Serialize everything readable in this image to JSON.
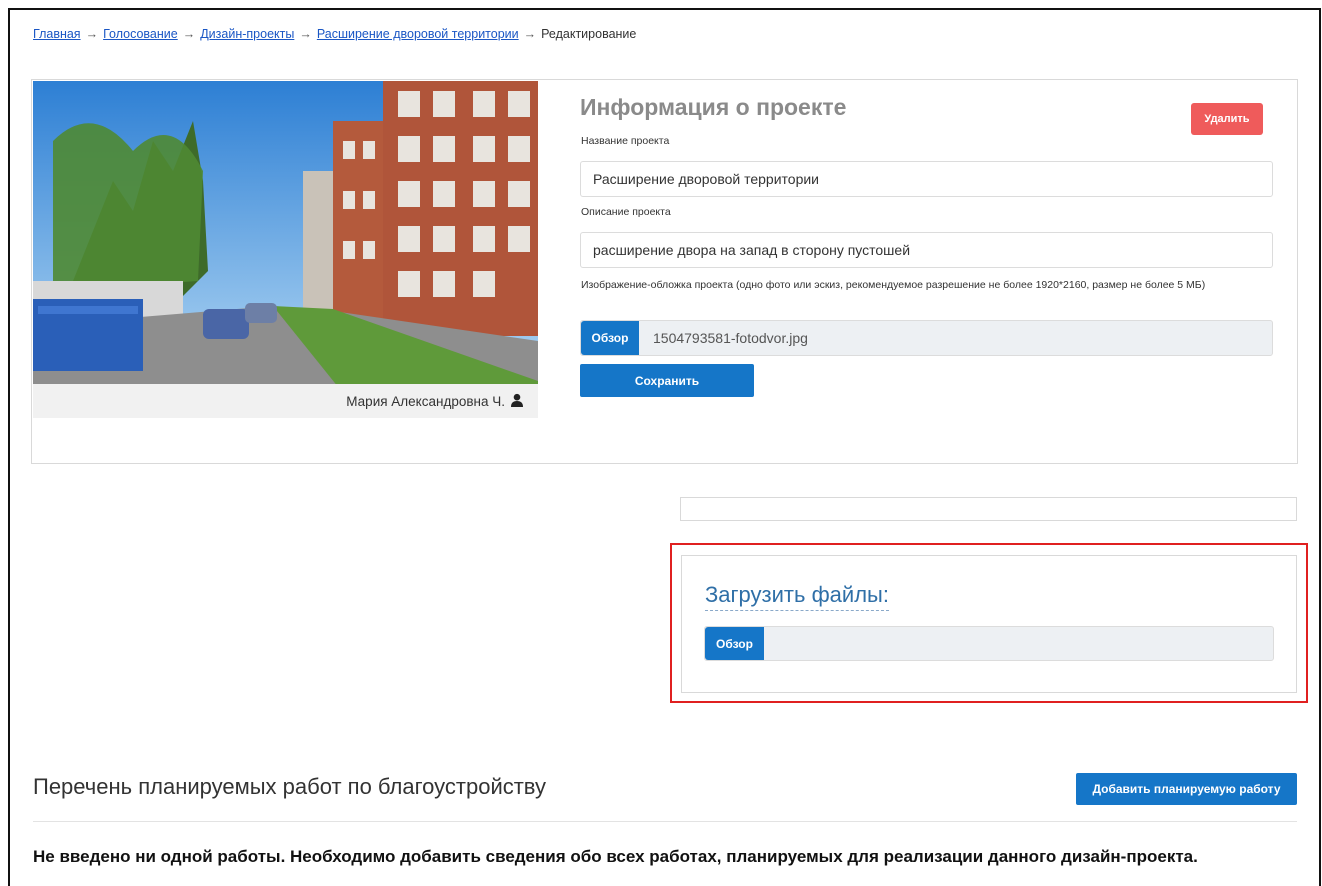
{
  "breadcrumb": {
    "items": [
      "Главная",
      "Голосование",
      "Дизайн-проекты",
      "Расширение дворовой территории"
    ],
    "current": "Редактирование",
    "separator": "→"
  },
  "project": {
    "title": "Информация о проекте",
    "delete_label": "Удалить",
    "name_label": "Название проекта",
    "name_value": "Расширение дворовой территории",
    "description_label": "Описание проекта",
    "description_value": "расширение двора на запад в сторону пустошей",
    "cover_hint": "Изображение-обложка проекта (одно фото или эскиз, рекомендуемое разрешение не более 1920*2160, размер не более 5 МБ)",
    "browse_label": "Обзор",
    "file_name": "1504793581-fotodvor.jpg",
    "save_label": "Сохранить",
    "author": "Мария Александровна Ч.",
    "author_icon": "user-icon"
  },
  "upload": {
    "title": "Загрузить файлы:",
    "browse_label": "Обзор"
  },
  "works": {
    "title": "Перечень планируемых работ по благоустройству",
    "add_label": "Добавить планируемую работу",
    "empty_message": "Не введено ни одной работы. Необходимо добавить сведения обо всех работах, планируемых для реализации данного дизайн-проекта."
  },
  "colors": {
    "primary": "#1576c8",
    "danger": "#ef5b5b",
    "highlight": "#e02020",
    "link": "#1a56c4"
  }
}
